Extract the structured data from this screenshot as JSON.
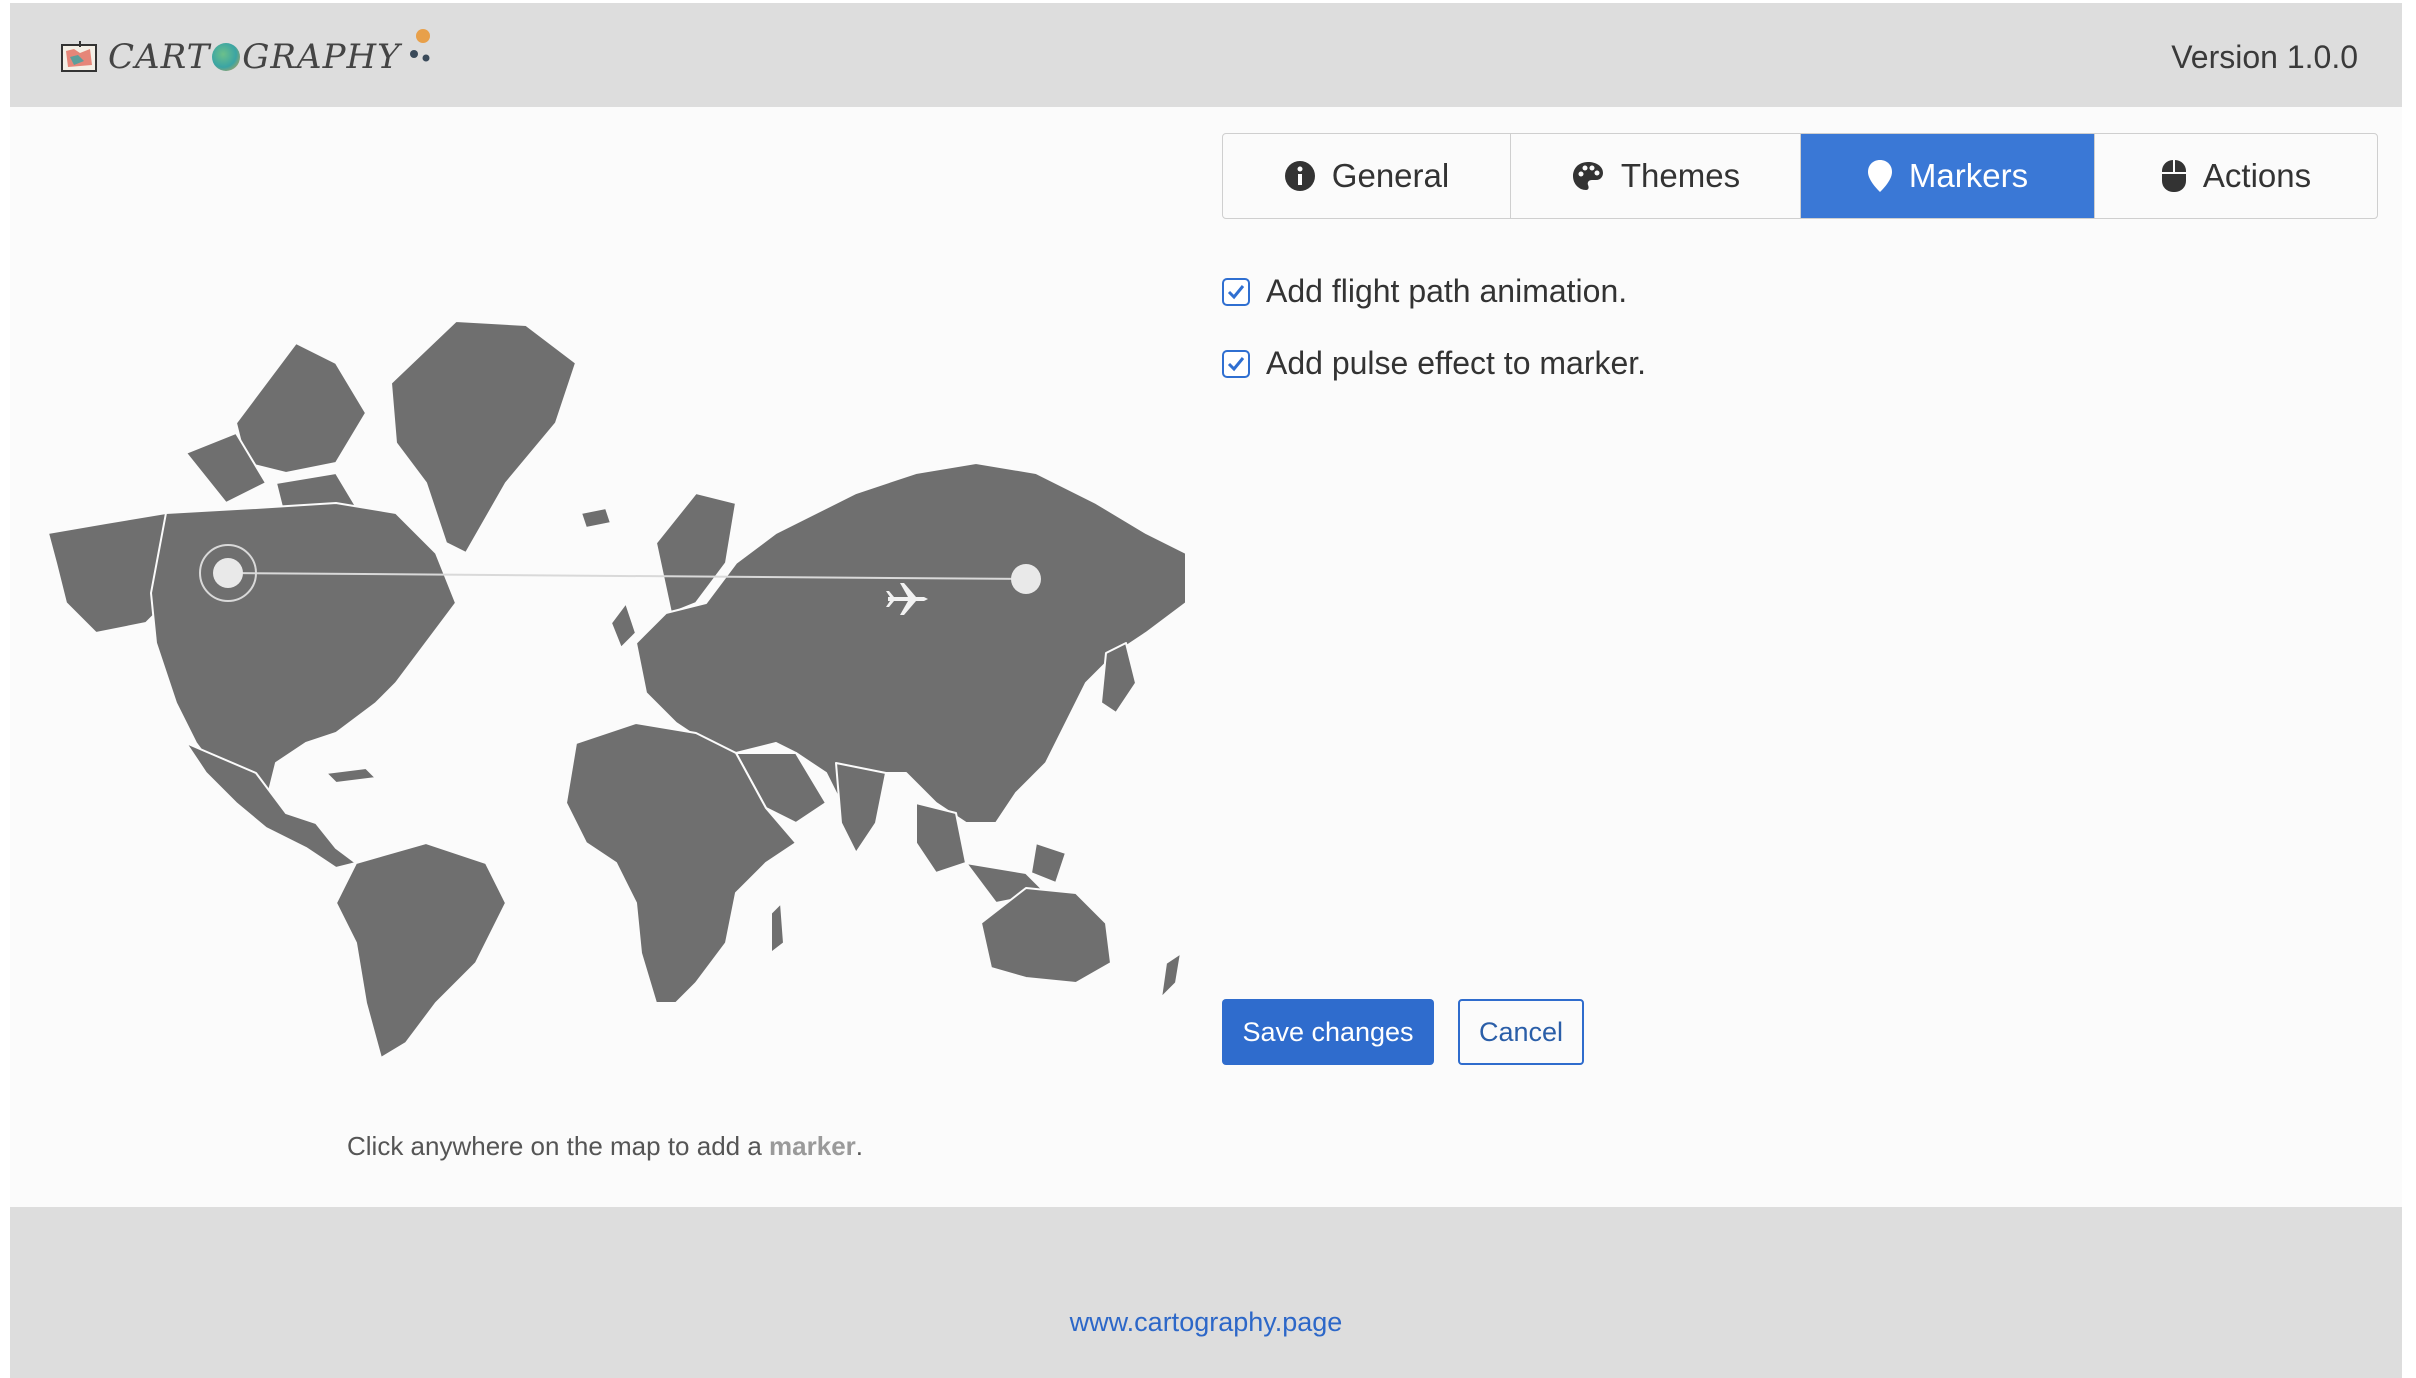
{
  "app": {
    "logo_text_1": "CART",
    "logo_text_2": "GRAPHY",
    "version": "Version 1.0.0"
  },
  "tabs": [
    {
      "label": "General",
      "icon": "info-icon",
      "active": false
    },
    {
      "label": "Themes",
      "icon": "palette-icon",
      "active": false
    },
    {
      "label": "Markers",
      "icon": "map-pin-icon",
      "active": true
    },
    {
      "label": "Actions",
      "icon": "mouse-icon",
      "active": false
    }
  ],
  "options": [
    {
      "label": "Add flight path animation.",
      "checked": true
    },
    {
      "label": "Add pulse effect to marker.",
      "checked": true
    }
  ],
  "buttons": {
    "save": "Save changes",
    "cancel": "Cancel"
  },
  "map": {
    "caption_prefix": "Click anywhere on the map to add a ",
    "caption_emphasis": "marker",
    "caption_suffix": ".",
    "land_color": "#6f6f6f",
    "marker_color": "#e9e9e9"
  },
  "footer": {
    "link": "www.cartography.page"
  },
  "colors": {
    "accent": "#3a78d6",
    "header_bg": "#dddddd",
    "page_bg": "#fbfbfb"
  }
}
